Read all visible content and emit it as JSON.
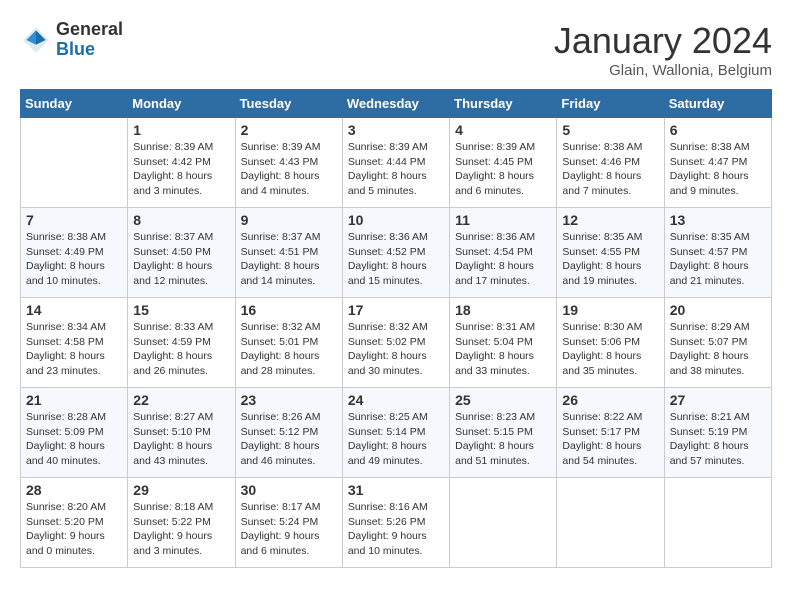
{
  "header": {
    "logo_general": "General",
    "logo_blue": "Blue",
    "month_year": "January 2024",
    "location": "Glain, Wallonia, Belgium"
  },
  "days_of_week": [
    "Sunday",
    "Monday",
    "Tuesday",
    "Wednesday",
    "Thursday",
    "Friday",
    "Saturday"
  ],
  "weeks": [
    [
      {
        "day": "",
        "info": ""
      },
      {
        "day": "1",
        "info": "Sunrise: 8:39 AM\nSunset: 4:42 PM\nDaylight: 8 hours\nand 3 minutes."
      },
      {
        "day": "2",
        "info": "Sunrise: 8:39 AM\nSunset: 4:43 PM\nDaylight: 8 hours\nand 4 minutes."
      },
      {
        "day": "3",
        "info": "Sunrise: 8:39 AM\nSunset: 4:44 PM\nDaylight: 8 hours\nand 5 minutes."
      },
      {
        "day": "4",
        "info": "Sunrise: 8:39 AM\nSunset: 4:45 PM\nDaylight: 8 hours\nand 6 minutes."
      },
      {
        "day": "5",
        "info": "Sunrise: 8:38 AM\nSunset: 4:46 PM\nDaylight: 8 hours\nand 7 minutes."
      },
      {
        "day": "6",
        "info": "Sunrise: 8:38 AM\nSunset: 4:47 PM\nDaylight: 8 hours\nand 9 minutes."
      }
    ],
    [
      {
        "day": "7",
        "info": "Sunrise: 8:38 AM\nSunset: 4:49 PM\nDaylight: 8 hours\nand 10 minutes."
      },
      {
        "day": "8",
        "info": "Sunrise: 8:37 AM\nSunset: 4:50 PM\nDaylight: 8 hours\nand 12 minutes."
      },
      {
        "day": "9",
        "info": "Sunrise: 8:37 AM\nSunset: 4:51 PM\nDaylight: 8 hours\nand 14 minutes."
      },
      {
        "day": "10",
        "info": "Sunrise: 8:36 AM\nSunset: 4:52 PM\nDaylight: 8 hours\nand 15 minutes."
      },
      {
        "day": "11",
        "info": "Sunrise: 8:36 AM\nSunset: 4:54 PM\nDaylight: 8 hours\nand 17 minutes."
      },
      {
        "day": "12",
        "info": "Sunrise: 8:35 AM\nSunset: 4:55 PM\nDaylight: 8 hours\nand 19 minutes."
      },
      {
        "day": "13",
        "info": "Sunrise: 8:35 AM\nSunset: 4:57 PM\nDaylight: 8 hours\nand 21 minutes."
      }
    ],
    [
      {
        "day": "14",
        "info": "Sunrise: 8:34 AM\nSunset: 4:58 PM\nDaylight: 8 hours\nand 23 minutes."
      },
      {
        "day": "15",
        "info": "Sunrise: 8:33 AM\nSunset: 4:59 PM\nDaylight: 8 hours\nand 26 minutes."
      },
      {
        "day": "16",
        "info": "Sunrise: 8:32 AM\nSunset: 5:01 PM\nDaylight: 8 hours\nand 28 minutes."
      },
      {
        "day": "17",
        "info": "Sunrise: 8:32 AM\nSunset: 5:02 PM\nDaylight: 8 hours\nand 30 minutes."
      },
      {
        "day": "18",
        "info": "Sunrise: 8:31 AM\nSunset: 5:04 PM\nDaylight: 8 hours\nand 33 minutes."
      },
      {
        "day": "19",
        "info": "Sunrise: 8:30 AM\nSunset: 5:06 PM\nDaylight: 8 hours\nand 35 minutes."
      },
      {
        "day": "20",
        "info": "Sunrise: 8:29 AM\nSunset: 5:07 PM\nDaylight: 8 hours\nand 38 minutes."
      }
    ],
    [
      {
        "day": "21",
        "info": "Sunrise: 8:28 AM\nSunset: 5:09 PM\nDaylight: 8 hours\nand 40 minutes."
      },
      {
        "day": "22",
        "info": "Sunrise: 8:27 AM\nSunset: 5:10 PM\nDaylight: 8 hours\nand 43 minutes."
      },
      {
        "day": "23",
        "info": "Sunrise: 8:26 AM\nSunset: 5:12 PM\nDaylight: 8 hours\nand 46 minutes."
      },
      {
        "day": "24",
        "info": "Sunrise: 8:25 AM\nSunset: 5:14 PM\nDaylight: 8 hours\nand 49 minutes."
      },
      {
        "day": "25",
        "info": "Sunrise: 8:23 AM\nSunset: 5:15 PM\nDaylight: 8 hours\nand 51 minutes."
      },
      {
        "day": "26",
        "info": "Sunrise: 8:22 AM\nSunset: 5:17 PM\nDaylight: 8 hours\nand 54 minutes."
      },
      {
        "day": "27",
        "info": "Sunrise: 8:21 AM\nSunset: 5:19 PM\nDaylight: 8 hours\nand 57 minutes."
      }
    ],
    [
      {
        "day": "28",
        "info": "Sunrise: 8:20 AM\nSunset: 5:20 PM\nDaylight: 9 hours\nand 0 minutes."
      },
      {
        "day": "29",
        "info": "Sunrise: 8:18 AM\nSunset: 5:22 PM\nDaylight: 9 hours\nand 3 minutes."
      },
      {
        "day": "30",
        "info": "Sunrise: 8:17 AM\nSunset: 5:24 PM\nDaylight: 9 hours\nand 6 minutes."
      },
      {
        "day": "31",
        "info": "Sunrise: 8:16 AM\nSunset: 5:26 PM\nDaylight: 9 hours\nand 10 minutes."
      },
      {
        "day": "",
        "info": ""
      },
      {
        "day": "",
        "info": ""
      },
      {
        "day": "",
        "info": ""
      }
    ]
  ]
}
